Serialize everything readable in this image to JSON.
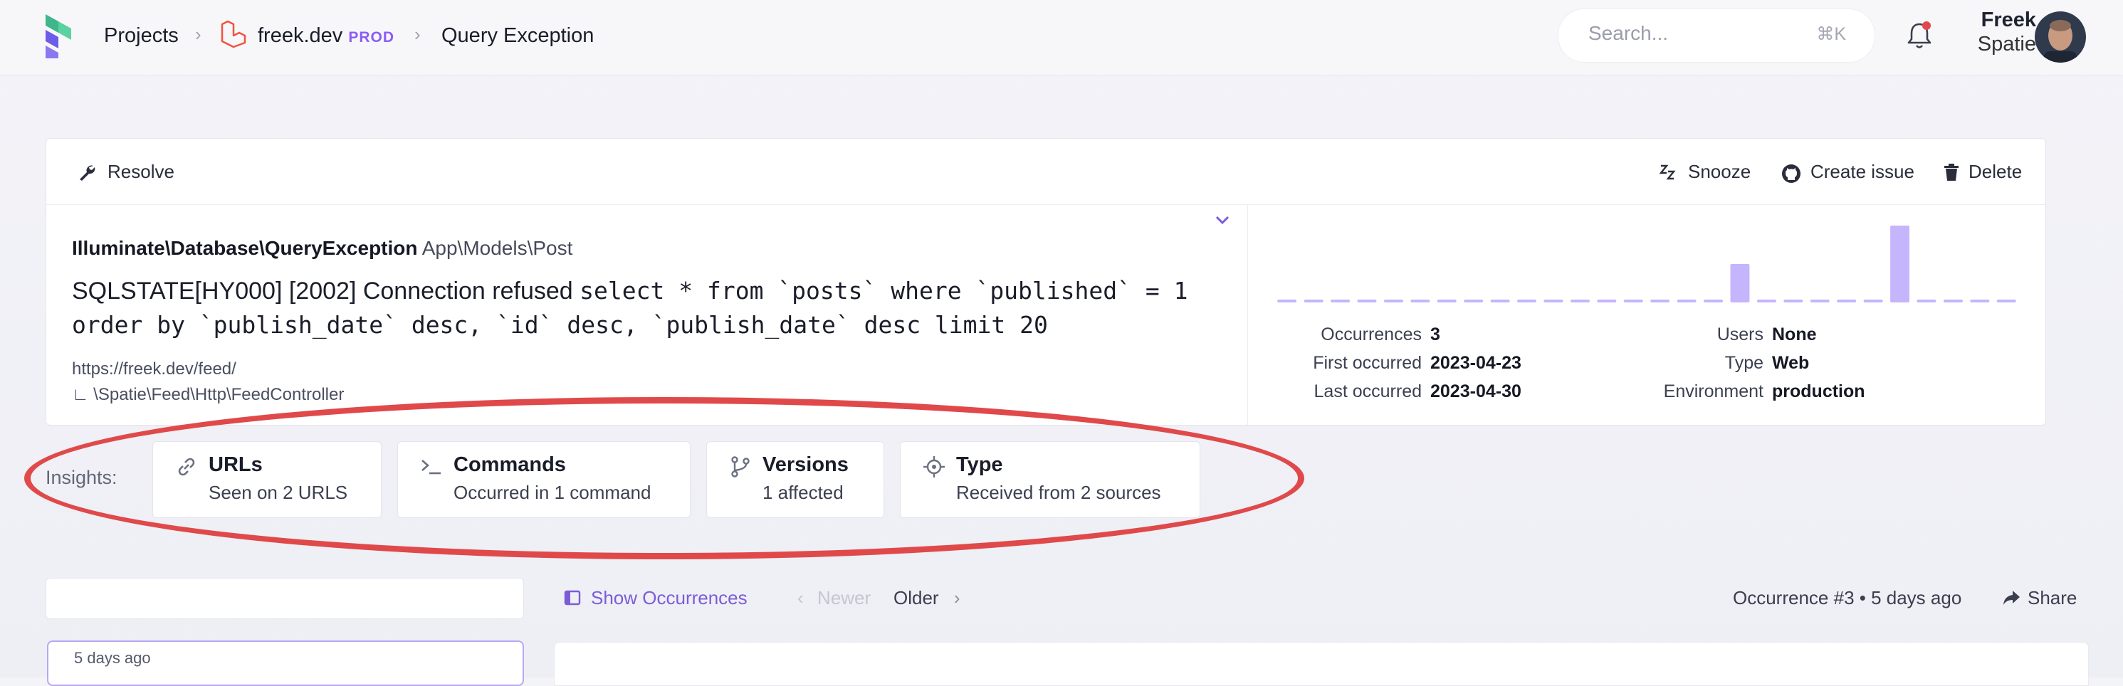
{
  "header": {
    "breadcrumbs": [
      "Projects",
      "freek.dev",
      "Query Exception"
    ],
    "env_badge": "PROD",
    "search_placeholder": "Search...",
    "search_shortcut": "⌘K",
    "user": {
      "first": "Freek",
      "last": "Spatie"
    },
    "notification_dot_color": "#e0494a"
  },
  "toolbar": {
    "resolve": "Resolve",
    "snooze": "Snooze",
    "create_issue": "Create issue",
    "delete": "Delete"
  },
  "exception": {
    "class": "Illuminate\\Database\\QueryException",
    "model": "App\\Models\\Post",
    "message_prefix": "SQLSTATE[HY000] [2002] Connection refused",
    "message_sql": "select * from `posts` where `published` = 1 order by `publish_date` desc, `id` desc, `publish_date` desc limit 20",
    "url": "https://freek.dev/feed/",
    "controller": "∟ \\Spatie\\Feed\\Http\\FeedController"
  },
  "stats": {
    "occurrences_label": "Occurrences",
    "occurrences": "3",
    "first_label": "First occurred",
    "first": "2023-04-23",
    "last_label": "Last occurred",
    "last": "2023-04-30",
    "users_label": "Users",
    "users": "None",
    "type_label": "Type",
    "type": "Web",
    "env_label": "Environment",
    "env": "production"
  },
  "chart_data": {
    "type": "bar",
    "values": [
      0,
      0,
      0,
      0,
      0,
      0,
      0,
      0,
      0,
      0,
      0,
      0,
      0,
      0,
      0,
      0,
      0,
      1,
      0,
      0,
      0,
      0,
      0,
      2,
      0,
      0,
      0,
      0
    ],
    "color": "#c4b5fd"
  },
  "insights": {
    "label": "Insights:",
    "cards": [
      {
        "icon": "link-icon",
        "title": "URLs",
        "subtitle": "Seen on 2 URLS"
      },
      {
        "icon": "terminal-icon",
        "title": "Commands",
        "subtitle": "Occurred in 1 command"
      },
      {
        "icon": "branch-icon",
        "title": "Versions",
        "subtitle": "1 affected"
      },
      {
        "icon": "target-icon",
        "title": "Type",
        "subtitle": "Received from 2 sources"
      }
    ]
  },
  "occurrence_nav": {
    "show": "Show Occurrences",
    "newer": "Newer",
    "older": "Older",
    "current": "Occurrence #3 • 5 days ago",
    "share": "Share"
  },
  "occurrence_list": [
    {
      "time": "5 days ago"
    }
  ],
  "colors": {
    "accent": "#7c5cd6",
    "highlight": "#e0494a"
  }
}
